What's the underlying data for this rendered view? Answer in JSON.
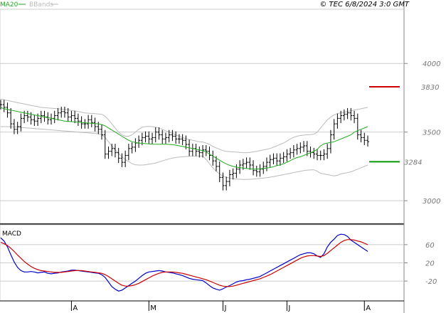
{
  "credit": "© TEC 6/8/2024 3:0 GMT",
  "legend": [
    {
      "label": "MA20",
      "color": "#22aa22"
    },
    {
      "label": "BBands",
      "color": "#bbbbbb"
    }
  ],
  "colors": {
    "bars": "#000000",
    "ma20": "#22aa22",
    "bbands": "#bbbbbb",
    "resistance": "#cc0000",
    "support": "#009900",
    "macd_line": "#0000cc",
    "signal_line": "#cc0000",
    "grid": "#cccccc"
  },
  "chart_data": [
    {
      "type": "line",
      "panel": "price",
      "y_ticks": [
        3000,
        3500,
        4000
      ],
      "y_tick_labels": [
        "3000",
        "3500",
        "4000"
      ],
      "ylim": [
        2840,
        4390
      ],
      "x_ticks": [
        "A",
        "M",
        "J",
        "J",
        "A"
      ],
      "x_tick_positions": [
        21,
        44,
        66,
        85,
        108
      ],
      "n_bars": 110,
      "levels": [
        {
          "name": "resistance",
          "value": 3830,
          "label": "3830"
        },
        {
          "name": "support",
          "value": 3284,
          "label": "3284"
        }
      ],
      "series": [
        {
          "name": "MA20",
          "values": [
            3680,
            3670,
            3665,
            3660,
            3655,
            3650,
            3645,
            3640,
            3635,
            3630,
            3625,
            3620,
            3615,
            3610,
            3605,
            3600,
            3595,
            3590,
            3585,
            3580,
            3578,
            3576,
            3574,
            3572,
            3570,
            3568,
            3566,
            3564,
            3562,
            3560,
            3555,
            3545,
            3530,
            3515,
            3500,
            3485,
            3470,
            3455,
            3440,
            3430,
            3425,
            3420,
            3418,
            3416,
            3414,
            3412,
            3412,
            3412,
            3412,
            3412,
            3410,
            3408,
            3405,
            3400,
            3395,
            3390,
            3385,
            3380,
            3375,
            3370,
            3365,
            3355,
            3340,
            3325,
            3310,
            3295,
            3280,
            3268,
            3258,
            3250,
            3245,
            3240,
            3238,
            3235,
            3232,
            3230,
            3230,
            3232,
            3235,
            3238,
            3242,
            3248,
            3255,
            3262,
            3270,
            3280,
            3292,
            3305,
            3315,
            3320,
            3330,
            3340,
            3350,
            3360,
            3375,
            3400,
            3415,
            3420,
            3425,
            3430,
            3440,
            3450,
            3460,
            3470,
            3480,
            3500,
            3510,
            3520,
            3530,
            3540
          ]
        },
        {
          "name": "BB upper",
          "values": [
            3740,
            3735,
            3730,
            3725,
            3720,
            3715,
            3710,
            3705,
            3700,
            3695,
            3690,
            3685,
            3680,
            3678,
            3676,
            3674,
            3672,
            3670,
            3668,
            3665,
            3662,
            3658,
            3654,
            3650,
            3645,
            3640,
            3638,
            3636,
            3634,
            3632,
            3630,
            3615,
            3590,
            3560,
            3530,
            3500,
            3480,
            3470,
            3470,
            3480,
            3500,
            3520,
            3535,
            3540,
            3542,
            3540,
            3535,
            3530,
            3520,
            3510,
            3500,
            3490,
            3480,
            3470,
            3460,
            3452,
            3445,
            3440,
            3435,
            3430,
            3428,
            3420,
            3410,
            3395,
            3385,
            3375,
            3365,
            3360,
            3358,
            3356,
            3354,
            3352,
            3350,
            3350,
            3352,
            3356,
            3360,
            3365,
            3370,
            3375,
            3380,
            3390,
            3400,
            3410,
            3420,
            3435,
            3450,
            3462,
            3470,
            3475,
            3478,
            3480,
            3482,
            3485,
            3500,
            3530,
            3560,
            3590,
            3610,
            3625,
            3635,
            3640,
            3645,
            3650,
            3655,
            3660,
            3665,
            3670,
            3675,
            3680
          ]
        },
        {
          "name": "BB lower",
          "values": [
            3540,
            3540,
            3540,
            3540,
            3538,
            3536,
            3534,
            3532,
            3530,
            3528,
            3526,
            3524,
            3522,
            3520,
            3518,
            3516,
            3514,
            3512,
            3510,
            3508,
            3506,
            3504,
            3502,
            3500,
            3498,
            3496,
            3494,
            3492,
            3490,
            3488,
            3480,
            3460,
            3430,
            3400,
            3370,
            3345,
            3320,
            3300,
            3285,
            3270,
            3262,
            3260,
            3260,
            3262,
            3266,
            3270,
            3275,
            3282,
            3290,
            3298,
            3305,
            3310,
            3315,
            3318,
            3320,
            3322,
            3324,
            3325,
            3326,
            3326,
            3325,
            3300,
            3270,
            3240,
            3215,
            3195,
            3180,
            3170,
            3165,
            3160,
            3158,
            3156,
            3155,
            3155,
            3156,
            3158,
            3160,
            3162,
            3165,
            3168,
            3172,
            3176,
            3180,
            3185,
            3190,
            3195,
            3200,
            3205,
            3210,
            3215,
            3220,
            3222,
            3224,
            3225,
            3215,
            3200,
            3195,
            3190,
            3185,
            3180,
            3185,
            3195,
            3200,
            3205,
            3210,
            3220,
            3230,
            3240,
            3250,
            3260
          ]
        },
        {
          "name": "Close",
          "values": [
            3700,
            3680,
            3640,
            3560,
            3520,
            3540,
            3600,
            3620,
            3610,
            3590,
            3580,
            3600,
            3620,
            3610,
            3590,
            3600,
            3620,
            3640,
            3650,
            3640,
            3610,
            3620,
            3600,
            3580,
            3560,
            3560,
            3590,
            3570,
            3540,
            3520,
            3480,
            3340,
            3360,
            3380,
            3350,
            3310,
            3280,
            3330,
            3380,
            3390,
            3420,
            3440,
            3460,
            3470,
            3450,
            3460,
            3500,
            3480,
            3450,
            3460,
            3480,
            3470,
            3450,
            3450,
            3440,
            3410,
            3360,
            3380,
            3360,
            3350,
            3370,
            3360,
            3330,
            3290,
            3250,
            3170,
            3110,
            3140,
            3190,
            3200,
            3230,
            3260,
            3270,
            3280,
            3260,
            3220,
            3210,
            3230,
            3250,
            3280,
            3300,
            3310,
            3290,
            3310,
            3320,
            3340,
            3350,
            3370,
            3380,
            3390,
            3400,
            3360,
            3350,
            3340,
            3330,
            3330,
            3340,
            3380,
            3480,
            3560,
            3600,
            3620,
            3630,
            3640,
            3620,
            3600,
            3480,
            3460,
            3440,
            3430
          ]
        }
      ]
    },
    {
      "type": "line",
      "panel": "macd",
      "title": "MACD",
      "y_ticks": [
        60,
        20,
        -20
      ],
      "y_tick_labels": [
        "60",
        "20",
        "-20"
      ],
      "ylim": [
        -62,
        102
      ],
      "series": [
        {
          "name": "MACD",
          "values": [
            75,
            68,
            55,
            38,
            22,
            10,
            3,
            0,
            0,
            1,
            0,
            -2,
            -1,
            0,
            -3,
            -4,
            -3,
            -2,
            0,
            1,
            2,
            4,
            4,
            3,
            2,
            1,
            0,
            -1,
            -2,
            -3,
            -6,
            -12,
            -22,
            -32,
            -38,
            -42,
            -40,
            -35,
            -30,
            -25,
            -20,
            -14,
            -8,
            -3,
            0,
            1,
            2,
            3,
            2,
            0,
            -1,
            -2,
            -4,
            -6,
            -8,
            -11,
            -14,
            -16,
            -17,
            -18,
            -19,
            -24,
            -30,
            -35,
            -38,
            -40,
            -37,
            -33,
            -30,
            -26,
            -22,
            -20,
            -19,
            -17,
            -16,
            -14,
            -12,
            -10,
            -6,
            -2,
            2,
            6,
            10,
            14,
            18,
            22,
            26,
            30,
            34,
            38,
            40,
            42,
            42,
            40,
            35,
            32,
            40,
            55,
            65,
            72,
            80,
            83,
            82,
            78,
            70,
            65,
            60,
            55,
            50,
            45
          ]
        },
        {
          "name": "Signal",
          "values": [
            65,
            62,
            58,
            52,
            45,
            37,
            30,
            23,
            17,
            12,
            8,
            5,
            3,
            2,
            1,
            0,
            -1,
            -1,
            -1,
            0,
            1,
            2,
            3,
            3,
            3,
            2,
            1,
            0,
            -1,
            -2,
            -3,
            -6,
            -10,
            -15,
            -20,
            -25,
            -29,
            -31,
            -31,
            -30,
            -28,
            -25,
            -21,
            -17,
            -13,
            -9,
            -6,
            -3,
            -1,
            0,
            0,
            0,
            -1,
            -2,
            -3,
            -5,
            -7,
            -9,
            -11,
            -13,
            -15,
            -17,
            -20,
            -23,
            -26,
            -29,
            -31,
            -32,
            -32,
            -31,
            -29,
            -27,
            -25,
            -23,
            -21,
            -19,
            -17,
            -15,
            -12,
            -9,
            -6,
            -2,
            2,
            6,
            10,
            14,
            18,
            22,
            26,
            30,
            33,
            35,
            36,
            36,
            35,
            34,
            36,
            41,
            47,
            53,
            59,
            65,
            69,
            71,
            71,
            70,
            68,
            66,
            63,
            60
          ]
        }
      ]
    }
  ]
}
